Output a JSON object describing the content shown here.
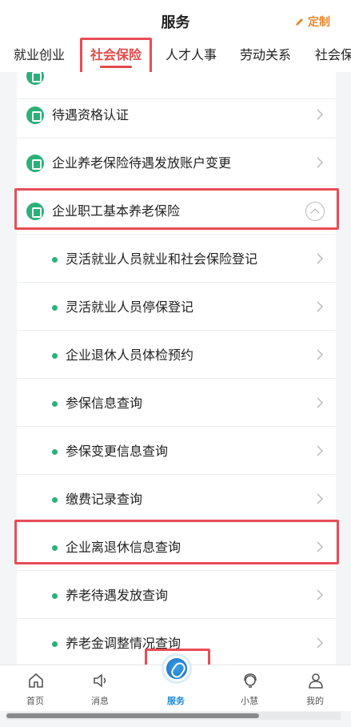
{
  "header": {
    "title": "服务",
    "custom_label": "定制"
  },
  "tabs": [
    {
      "label": "就业创业"
    },
    {
      "label": "社会保险"
    },
    {
      "label": "人才人事"
    },
    {
      "label": "劳动关系"
    },
    {
      "label": "社会保"
    }
  ],
  "list": {
    "items": [
      {
        "label": "待遇资格认证"
      },
      {
        "label": "企业养老保险待遇发放账户变更"
      },
      {
        "label": "企业职工基本养老保险"
      }
    ],
    "subitems": [
      {
        "label": "灵活就业人员就业和社会保险登记"
      },
      {
        "label": "灵活就业人员停保登记"
      },
      {
        "label": "企业退休人员体检预约"
      },
      {
        "label": "参保信息查询"
      },
      {
        "label": "参保变更信息查询"
      },
      {
        "label": "缴费记录查询"
      },
      {
        "label": "企业离退休信息查询"
      },
      {
        "label": "养老待遇发放查询"
      },
      {
        "label": "养老金调整情况查询"
      }
    ]
  },
  "bottom_nav": [
    {
      "label": "首页",
      "icon": "home-icon"
    },
    {
      "label": "消息",
      "icon": "speaker-icon"
    },
    {
      "label": "服务",
      "icon": "service-icon"
    },
    {
      "label": "小慧",
      "icon": "assistant-icon"
    },
    {
      "label": "我的",
      "icon": "user-icon"
    }
  ],
  "colors": {
    "accent_red": "#e24a4a",
    "green": "#2bb07a",
    "blue": "#1e8bd8",
    "orange": "#e9862a"
  }
}
